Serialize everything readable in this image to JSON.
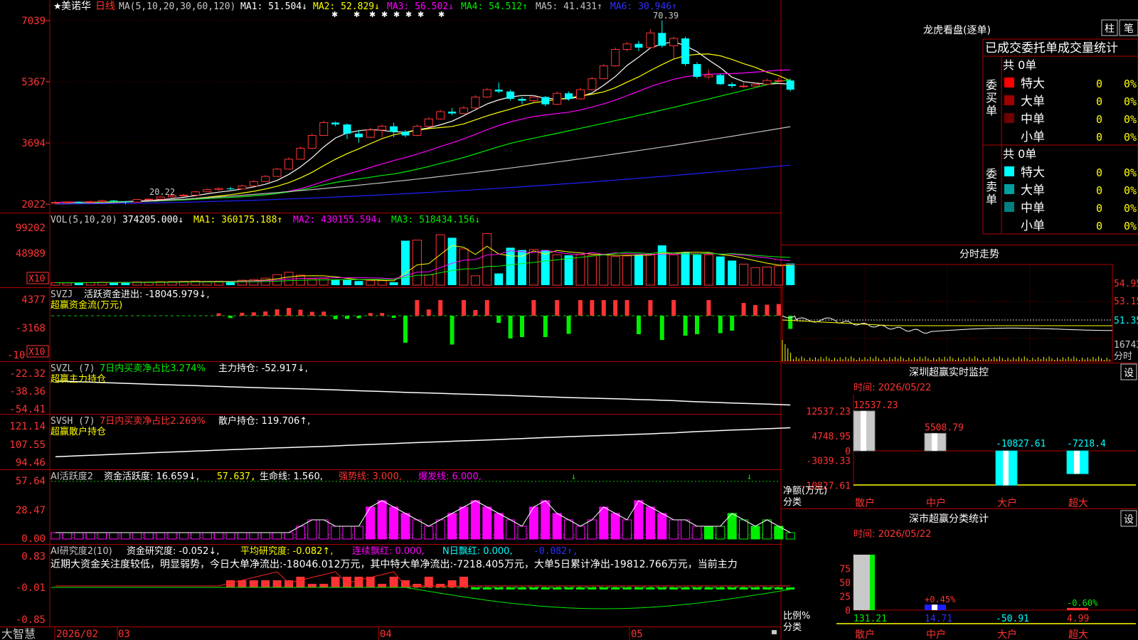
{
  "colors": {
    "red": "#ff3333",
    "cyan": "#00ffff",
    "green": "#00ee00",
    "yellow": "#ffff00",
    "magenta": "#ff00ff",
    "white": "#ffffff",
    "blue": "#2020ff",
    "grey": "#c0c0c0",
    "border": "#b00000"
  },
  "left": {
    "price_panel": {
      "star": "★",
      "stock_name": "美诺华",
      "period": "日线",
      "ma_params": "MA(5,10,20,30,60,120)",
      "ma_labels": [
        {
          "text": "MA1: 51.504↓",
          "color": "#ffffff"
        },
        {
          "text": "MA2: 52.829↓",
          "color": "#ffff00"
        },
        {
          "text": "MA3: 56.502↓",
          "color": "#ff00ff"
        },
        {
          "text": "MA4: 54.512↑",
          "color": "#00ee00"
        },
        {
          "text": "MA5: 41.431↑",
          "color": "#c0c0c0"
        },
        {
          "text": "MA6: 30.946↑",
          "color": "#3030ff"
        }
      ],
      "y_ticks": [
        "7039",
        "5367",
        "3694",
        "2022"
      ],
      "high_label": "70.39",
      "low_label": "20.22"
    },
    "vol_panel": {
      "header": "VOL(5,10,20)",
      "labels": [
        {
          "text": "374205.000↓",
          "color": "#ffffff"
        },
        {
          "text": "MA1: 360175.188↑",
          "color": "#ffff00"
        },
        {
          "text": "MA2: 430155.594↓",
          "color": "#ff00ff"
        },
        {
          "text": "MA3: 518434.156↓",
          "color": "#00ee00"
        }
      ],
      "y_ticks": [
        "99202",
        "48989"
      ],
      "unit": "X10"
    },
    "svzj_panel": {
      "header": "SVZJ",
      "label": "活跃资金进出: -18045.979↓,",
      "subtitle": "超赢资金流(万元)",
      "y_ticks": [
        "4377",
        "-3168",
        "-10"
      ],
      "unit": "X10"
    },
    "svzl_panel": {
      "header": "SVZL (7)",
      "ratio": "7日内买卖净占比3.274%",
      "label": "主力持仓: -52.917↓,",
      "subtitle": "超赢主力持仓",
      "y_ticks": [
        "-22.32",
        "-38.36",
        "-54.41"
      ]
    },
    "svsh_panel": {
      "header": "SVSH (7)",
      "ratio": "7日内买卖净占比2.269%",
      "label": "散户持仓: 119.706↑,",
      "subtitle": "超赢散户持仓",
      "y_ticks": [
        "121.14",
        "107.55",
        "94.46"
      ]
    },
    "ai_active_panel": {
      "header": "AI活跃度2",
      "label1": "资金活跃度: 16.659↓,",
      "label2": "57.637,",
      "label3": "生命线: 1.560,",
      "label4": "强势线: 3.000,",
      "label5": "爆发线: 6.000,",
      "y_ticks": [
        "57.64",
        "28.47",
        "0.00"
      ]
    },
    "ai_research_panel": {
      "header": "AI研究度2(10)",
      "label1": "资金研究度: -0.052↓,",
      "label2": "平均研究度: -0.082↑,",
      "label3": "连续飘红: 0.000,",
      "label4": "N日飘红: 0.000,",
      "label5": "-0.082↑,",
      "commentary": "近期大资金关注度较低，明显弱势，今日大单净流出:-18046.012万元，其中特大单净流出:-7218.405万元，大单5日累计净出-19812.766万元，当前主力",
      "y_ticks": [
        "0.83",
        "-0.01",
        "-0.85"
      ]
    },
    "x_axis": {
      "brand": "大智慧",
      "labels": [
        "2026/02",
        "03",
        "04",
        "05"
      ]
    }
  },
  "right": {
    "dragon_tiger": {
      "title": "龙虎看盘(逐单)",
      "btn_bar": "柱",
      "btn_tick": "笔",
      "subtitle": "已成交委托单成交量统计",
      "buy": {
        "label": "委买单",
        "total": "共 0单",
        "rows": [
          {
            "name": "特大",
            "count": "0",
            "pct": "0%",
            "color": "#ff0000"
          },
          {
            "name": "大单",
            "count": "0",
            "pct": "0%",
            "color": "#a00000"
          },
          {
            "name": "中单",
            "count": "0",
            "pct": "0%",
            "color": "#700000"
          },
          {
            "name": "小单",
            "count": "0",
            "pct": "0%",
            "color": ""
          }
        ]
      },
      "sell": {
        "label": "委卖单",
        "total": "共 0单",
        "rows": [
          {
            "name": "特大",
            "count": "0",
            "pct": "0%",
            "color": "#00ffff"
          },
          {
            "name": "大单",
            "count": "0",
            "pct": "0%",
            "color": "#00a0a0"
          },
          {
            "name": "中单",
            "count": "0",
            "pct": "0%",
            "color": "#008080"
          },
          {
            "name": "小单",
            "count": "0",
            "pct": "0%",
            "color": ""
          }
        ]
      }
    },
    "intraday": {
      "title": "分时走势",
      "prices": [
        "54.95",
        "53.15",
        "51.35"
      ],
      "vol_label": "16743",
      "vol_unit": "分时"
    },
    "sz_monitor": {
      "title": "深圳超赢实时监控",
      "btn": "设",
      "date": "时间: 2026/05/22",
      "y_ticks": [
        "12537.23",
        "4748.95",
        "0",
        "-3039.33",
        "-10827.61"
      ],
      "ylabel": "净额(万元)",
      "xlabel": "分类",
      "categories": [
        "散户",
        "中户",
        "大户",
        "超大"
      ],
      "values": [
        12537.23,
        5508.79,
        -10827.61,
        -7218.4
      ],
      "value_labels": [
        "12537.23",
        "5508.79",
        "-10827.61",
        "-7218.4"
      ]
    },
    "sz_class": {
      "title": "深市超赢分类统计",
      "btn": "设",
      "date": "时间: 2026/05/22",
      "y_ticks": [
        "75",
        "50",
        "25",
        "0"
      ],
      "ylabel": "比例%",
      "xlabel": "分类",
      "categories": [
        "散户",
        "中户",
        "大户",
        "超大"
      ],
      "pct_labels": [
        "",
        "+0.45%",
        "",
        "-0.60%"
      ],
      "values": [
        "131.21",
        "14.71",
        "-50.91",
        "4.99"
      ]
    }
  },
  "chart_data": {
    "type": "candlestick",
    "candles": [
      [
        20.5,
        20.7,
        21.1,
        20.3
      ],
      [
        20.6,
        20.8,
        21.0,
        20.4
      ],
      [
        20.8,
        20.7,
        21.0,
        20.5
      ],
      [
        20.7,
        20.9,
        21.2,
        20.5
      ],
      [
        20.9,
        21.2,
        21.4,
        20.8
      ],
      [
        21.2,
        21.0,
        21.4,
        20.9
      ],
      [
        21.0,
        20.8,
        21.1,
        20.22
      ],
      [
        20.8,
        21.5,
        21.6,
        20.7
      ],
      [
        21.5,
        21.6,
        21.8,
        21.3
      ],
      [
        21.6,
        22.2,
        22.4,
        21.5
      ],
      [
        22.2,
        22.6,
        22.8,
        22.0
      ],
      [
        22.6,
        22.7,
        23.0,
        22.4
      ],
      [
        22.7,
        23.6,
        23.9,
        22.6
      ],
      [
        23.6,
        24.2,
        24.5,
        23.5
      ],
      [
        24.2,
        24.5,
        24.8,
        23.9
      ],
      [
        24.5,
        24.4,
        24.9,
        24.1
      ],
      [
        24.4,
        25.2,
        25.5,
        24.3
      ],
      [
        25.2,
        26.4,
        26.8,
        25.1
      ],
      [
        26.4,
        27.8,
        28.2,
        26.3
      ],
      [
        27.8,
        29.8,
        30.2,
        27.7
      ],
      [
        29.8,
        32.5,
        33.0,
        29.7
      ],
      [
        32.5,
        35.5,
        36.0,
        32.4
      ],
      [
        35.5,
        39.0,
        39.5,
        35.3
      ],
      [
        39.0,
        42.5,
        43.0,
        38.9
      ],
      [
        42.5,
        42.0,
        42.8,
        41.5
      ],
      [
        42.0,
        39.5,
        42.3,
        38.0
      ],
      [
        39.5,
        38.5,
        40.5,
        37.0
      ],
      [
        38.5,
        40.5,
        41.0,
        38.3
      ],
      [
        40.5,
        41.5,
        42.0,
        38.5
      ],
      [
        41.5,
        40.0,
        42.5,
        38.5
      ],
      [
        40.0,
        39.0,
        40.5,
        38.5
      ],
      [
        39.0,
        41.5,
        42.0,
        38.8
      ],
      [
        41.5,
        43.5,
        44.0,
        41.3
      ],
      [
        43.5,
        45.5,
        46.0,
        43.3
      ],
      [
        45.5,
        45.0,
        46.5,
        44.5
      ],
      [
        45.0,
        46.5,
        47.0,
        44.8
      ],
      [
        46.5,
        49.5,
        50.0,
        46.3
      ],
      [
        49.5,
        51.5,
        52.0,
        49.3
      ],
      [
        51.5,
        51.0,
        53.5,
        50.5
      ],
      [
        51.0,
        49.0,
        51.5,
        48.5
      ],
      [
        49.0,
        48.5,
        49.5,
        47.5
      ],
      [
        48.5,
        49.5,
        50.0,
        48.0
      ],
      [
        49.5,
        47.5,
        49.8,
        47.0
      ],
      [
        47.5,
        50.5,
        51.0,
        47.3
      ],
      [
        50.5,
        49.0,
        51.0,
        48.5
      ],
      [
        49.0,
        51.5,
        52.0,
        48.8
      ],
      [
        51.5,
        54.5,
        55.0,
        51.3
      ],
      [
        54.5,
        58.0,
        58.5,
        54.3
      ],
      [
        58.0,
        62.5,
        63.0,
        57.8
      ],
      [
        62.5,
        64.0,
        64.5,
        62.0
      ],
      [
        64.0,
        63.0,
        64.8,
        62.0
      ],
      [
        63.0,
        67.0,
        68.0,
        62.8
      ],
      [
        67.0,
        63.5,
        70.39,
        63.0
      ],
      [
        63.5,
        65.5,
        66.0,
        60.0
      ],
      [
        65.5,
        58.5,
        66.0,
        58.0
      ],
      [
        58.5,
        55.0,
        59.0,
        54.5
      ],
      [
        55.0,
        55.5,
        57.0,
        54.5
      ],
      [
        55.5,
        53.0,
        55.8,
        52.8
      ],
      [
        53.0,
        52.5,
        53.5,
        52.0
      ],
      [
        52.5,
        52.5,
        53.5,
        52.0
      ],
      [
        52.5,
        53.0,
        53.5,
        52.3
      ],
      [
        53.0,
        54.0,
        54.5,
        52.8
      ],
      [
        54.0,
        54.0,
        54.8,
        53.5
      ],
      [
        54.0,
        51.5,
        54.5,
        51.0
      ]
    ],
    "volume_x10": [
      2100,
      2000,
      2200,
      2300,
      2500,
      2400,
      2600,
      2800,
      2600,
      3000,
      3100,
      3300,
      3500,
      3200,
      3400,
      3300,
      4200,
      4800,
      6000,
      9000,
      11000,
      8500,
      5500,
      5800,
      4800,
      4500,
      3500,
      3800,
      3800,
      2500,
      38000,
      38500,
      8800,
      43000,
      40500,
      31000,
      8000,
      44000,
      10000,
      32000,
      30000,
      30500,
      30000,
      26000,
      25500,
      26000,
      25500,
      26500,
      24500,
      25000,
      26000,
      26500,
      34000,
      26000,
      28000,
      26000,
      26000,
      24500,
      21000,
      18000,
      15000,
      15500,
      16500,
      18500
    ],
    "ai_active": [
      1,
      1,
      1,
      1,
      1,
      1,
      1,
      1,
      1,
      1,
      1,
      1,
      1,
      1,
      1,
      1,
      1,
      1,
      1,
      1,
      1,
      2,
      3,
      3,
      2,
      2,
      2,
      5,
      6,
      5,
      4,
      3,
      2,
      3,
      4,
      5,
      6,
      5,
      4,
      3,
      2,
      5,
      6,
      4,
      3,
      2,
      3,
      5,
      4,
      3,
      6,
      5,
      4,
      3,
      3,
      2,
      2,
      2,
      4,
      3,
      2,
      3,
      2,
      1
    ]
  }
}
